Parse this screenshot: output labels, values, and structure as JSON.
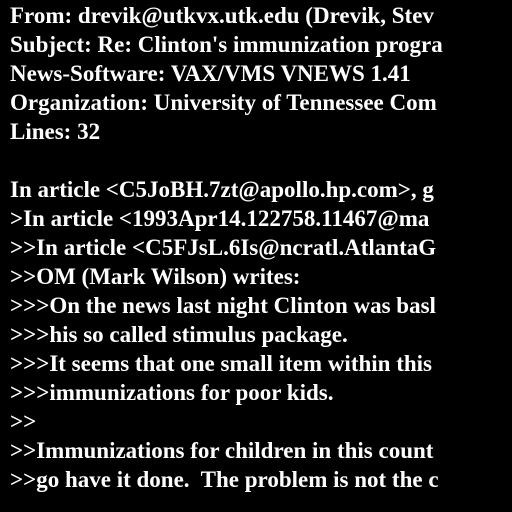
{
  "colors": {
    "background": "#000000",
    "text": "#ffffff"
  },
  "lines": [
    "From: drevik@utkvx.utk.edu (Drevik, Stev",
    "Subject: Re: Clinton's immunization progra",
    "News-Software: VAX/VMS VNEWS 1.41",
    "Organization: University of Tennessee Com",
    "Lines: 32",
    "",
    "In article <C5JoBH.7zt@apollo.hp.com>, g",
    ">In article <1993Apr14.122758.11467@ma",
    ">>In article <C5FJsL.6Is@ncratl.AtlantaG",
    ">>OM (Mark Wilson) writes:",
    ">>>On the news last night Clinton was basl",
    ">>>his so called stimulus package.",
    ">>>It seems that one small item within this",
    ">>>immunizations for poor kids.",
    ">>",
    ">>Immunizations for children in this count",
    ">>go have it done.  The problem is not the c"
  ]
}
